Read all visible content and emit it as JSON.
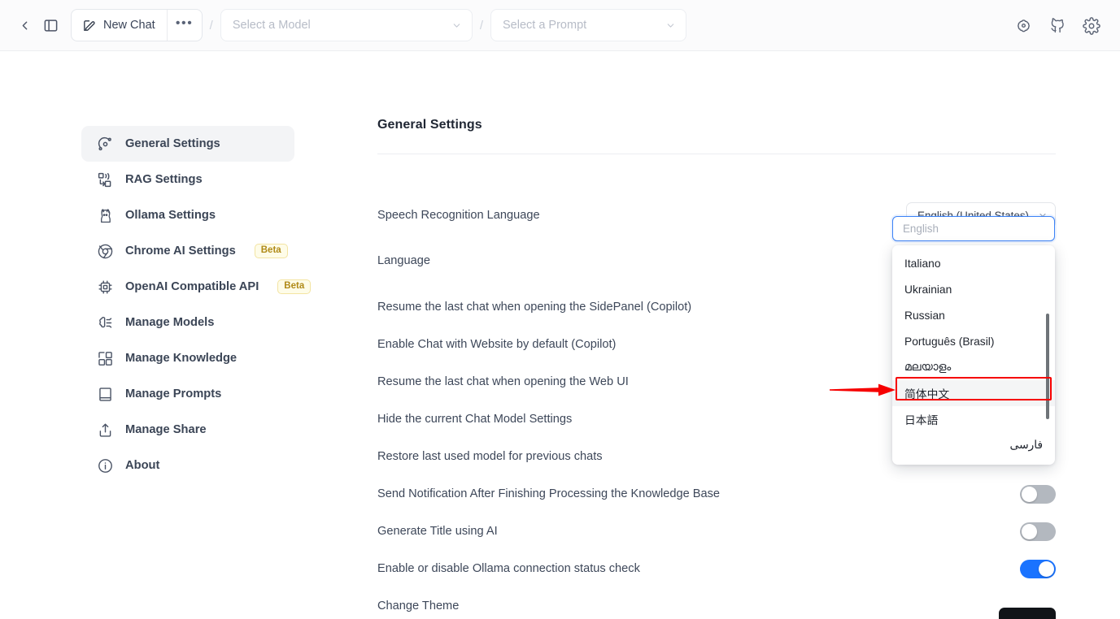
{
  "topbar": {
    "back_icon": "chevron-left-icon",
    "panel_icon": "side-panel-icon",
    "new_chat_label": "New Chat",
    "new_chat_icon": "edit-square-icon",
    "more_label": "•••",
    "separator": "/",
    "model_select_placeholder": "Select a Model",
    "prompt_select_placeholder": "Select a Prompt",
    "right_icons": [
      {
        "name": "brain-circuit-icon"
      },
      {
        "name": "github-icon"
      },
      {
        "name": "settings-gear-icon"
      }
    ]
  },
  "sidebar": {
    "items": [
      {
        "label": "General Settings",
        "icon": "orbit-settings-icon",
        "active": true,
        "badge": ""
      },
      {
        "label": "RAG Settings",
        "icon": "rag-flow-icon",
        "active": false,
        "badge": ""
      },
      {
        "label": "Ollama Settings",
        "icon": "llama-icon",
        "active": false,
        "badge": ""
      },
      {
        "label": "Chrome AI Settings",
        "icon": "chrome-icon",
        "active": false,
        "badge": "Beta"
      },
      {
        "label": "OpenAI Compatible API",
        "icon": "chip-icon",
        "active": false,
        "badge": "Beta"
      },
      {
        "label": "Manage Models",
        "icon": "brain-icon",
        "active": false,
        "badge": ""
      },
      {
        "label": "Manage Knowledge",
        "icon": "blocks-icon",
        "active": false,
        "badge": ""
      },
      {
        "label": "Manage Prompts",
        "icon": "book-icon",
        "active": false,
        "badge": ""
      },
      {
        "label": "Manage Share",
        "icon": "share-upload-icon",
        "active": false,
        "badge": ""
      },
      {
        "label": "About",
        "icon": "info-circle-icon",
        "active": false,
        "badge": ""
      }
    ]
  },
  "main": {
    "title": "General Settings",
    "rows": [
      {
        "label": "Speech Recognition Language",
        "control": "select",
        "value": "English (United States)"
      },
      {
        "label": "Language",
        "control": "lang-dropdown",
        "value": ""
      },
      {
        "label": "Resume the last chat when opening the SidePanel (Copilot)",
        "control": "hidden",
        "value": ""
      },
      {
        "label": "Enable Chat with Website by default (Copilot)",
        "control": "hidden",
        "value": ""
      },
      {
        "label": "Resume the last chat when opening the Web UI",
        "control": "hidden",
        "value": ""
      },
      {
        "label": "Hide the current Chat Model Settings",
        "control": "hidden",
        "value": ""
      },
      {
        "label": "Restore last used model for previous chats",
        "control": "hidden",
        "value": ""
      },
      {
        "label": "Send Notification After Finishing Processing the Knowledge Base",
        "control": "toggle-off",
        "value": "off"
      },
      {
        "label": "Generate Title using AI",
        "control": "toggle-off",
        "value": "off"
      },
      {
        "label": "Enable or disable Ollama connection status check",
        "control": "toggle-on",
        "value": "on"
      },
      {
        "label": "Change Theme",
        "control": "theme",
        "value": ""
      }
    ]
  },
  "language_dropdown": {
    "search_placeholder": "English",
    "search_value": "",
    "search_icon": "search-icon",
    "options": [
      {
        "label": "Italiano",
        "rtl": false,
        "highlighted": false
      },
      {
        "label": "Ukrainian",
        "rtl": false,
        "highlighted": false
      },
      {
        "label": "Russian",
        "rtl": false,
        "highlighted": false
      },
      {
        "label": "Português (Brasil)",
        "rtl": false,
        "highlighted": false
      },
      {
        "label": "മലയാളം",
        "rtl": false,
        "highlighted": false
      },
      {
        "label": "简体中文",
        "rtl": false,
        "highlighted": true
      },
      {
        "label": "日本語",
        "rtl": false,
        "highlighted": false
      },
      {
        "label": "فارسی",
        "rtl": true,
        "highlighted": false
      }
    ]
  },
  "annotation": {
    "highlight_color": "#f60000",
    "arrow_target": "简体中文"
  },
  "colors": {
    "accent": "#1a73ff",
    "topbar_bg": "#fbfbfc",
    "sidebar_active_bg": "#f3f4f6",
    "beta_badge": "#b08a17",
    "annotation_red": "#f60000"
  }
}
